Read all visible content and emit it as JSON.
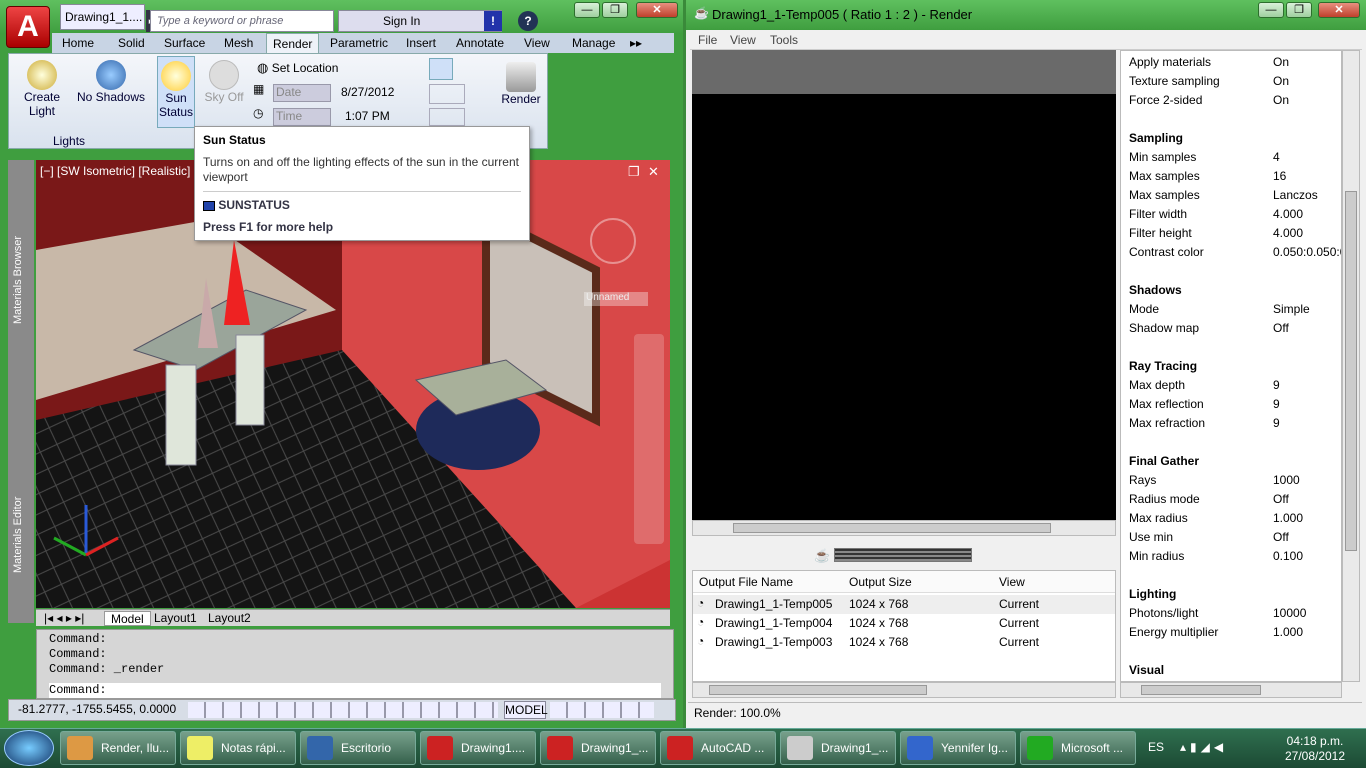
{
  "acad": {
    "title": "Drawing1_1....",
    "search_placeholder": "Type a keyword or phrase",
    "signin": "Sign In",
    "tabs": [
      "Home",
      "Solid",
      "Surface",
      "Mesh",
      "Render",
      "Parametric",
      "Insert",
      "Annotate",
      "View",
      "Manage"
    ],
    "ribbon": {
      "create_light": "Create Light",
      "no_shadows": "No Shadows",
      "sun_status": "Sun Status",
      "sky_off": "Sky Off",
      "set_location": "Set Location",
      "date_label": "Date",
      "date_value": "8/27/2012",
      "time_label": "Time",
      "time_value": "1:07 PM",
      "render": "Render",
      "lights_panel": "Lights"
    },
    "tooltip": {
      "title": "Sun Status",
      "desc": "Turns on and off the lighting effects of the sun in the current viewport",
      "command": "SUNSTATUS",
      "help": "Press F1 for more help"
    },
    "viewport_label": "[−] [SW Isometric] [Realistic]",
    "viewcube_label": "Unnamed",
    "sidebar_top": "Materials Browser",
    "sidebar_bottom": "Materials Editor",
    "layout_tabs": [
      "Model",
      "Layout1",
      "Layout2"
    ],
    "command_lines": [
      "Command:",
      "Command:",
      "Command: _render"
    ],
    "command_prompt": "Command:",
    "coords": "-81.2777, -1755.5455, 0.0000",
    "model_btn": "MODEL"
  },
  "render": {
    "title": "Drawing1_1-Temp005  ( Ratio 1 : 2 ) - Render",
    "menu": [
      "File",
      "View",
      "Tools"
    ],
    "output_headers": [
      "Output File Name",
      "Output Size",
      "View"
    ],
    "outputs": [
      {
        "name": "Drawing1_1-Temp005",
        "size": "1024 x 768",
        "view": "Current"
      },
      {
        "name": "Drawing1_1-Temp004",
        "size": "1024 x 768",
        "view": "Current"
      },
      {
        "name": "Drawing1_1-Temp003",
        "size": "1024 x 768",
        "view": "Current"
      }
    ],
    "status": "Render: 100.0%",
    "props_top": [
      {
        "k": "Apply materials",
        "v": "On"
      },
      {
        "k": "Texture sampling",
        "v": "On"
      },
      {
        "k": "Force 2-sided",
        "v": "On"
      }
    ],
    "sections": [
      {
        "name": "Sampling",
        "rows": [
          {
            "k": "Min samples",
            "v": "4"
          },
          {
            "k": "Max samples",
            "v": "16"
          },
          {
            "k": "Max samples",
            "v": "Lanczos"
          },
          {
            "k": "Filter width",
            "v": "4.000"
          },
          {
            "k": "Filter height",
            "v": "4.000"
          },
          {
            "k": "Contrast color",
            "v": "0.050:0.050:0.0"
          }
        ]
      },
      {
        "name": "Shadows",
        "rows": [
          {
            "k": "Mode",
            "v": "Simple"
          },
          {
            "k": "Shadow map",
            "v": "Off"
          }
        ]
      },
      {
        "name": "Ray Tracing",
        "rows": [
          {
            "k": "Max depth",
            "v": "9"
          },
          {
            "k": "Max reflection",
            "v": "9"
          },
          {
            "k": "Max refraction",
            "v": "9"
          }
        ]
      },
      {
        "name": "Final Gather",
        "rows": [
          {
            "k": "Rays",
            "v": "1000"
          },
          {
            "k": "Radius mode",
            "v": "Off"
          },
          {
            "k": "Max radius",
            "v": "1.000"
          },
          {
            "k": "Use min",
            "v": "Off"
          },
          {
            "k": "Min radius",
            "v": "0.100"
          }
        ]
      },
      {
        "name": "Lighting",
        "rows": [
          {
            "k": "Photons/light",
            "v": "10000"
          },
          {
            "k": "Energy multiplier",
            "v": "1.000"
          }
        ]
      },
      {
        "name": "Visual",
        "rows": []
      }
    ]
  },
  "taskbar": {
    "items": [
      {
        "label": "Render, Ilu...",
        "color": "#d94"
      },
      {
        "label": "Notas rápi...",
        "color": "#ee6"
      },
      {
        "label": "Escritorio",
        "color": "#36a"
      },
      {
        "label": "Drawing1....",
        "color": "#c22"
      },
      {
        "label": "Drawing1_...",
        "color": "#c22"
      },
      {
        "label": "AutoCAD ...",
        "color": "#c22"
      },
      {
        "label": "Drawing1_...",
        "color": "#ccc"
      },
      {
        "label": "Yennifer Ig...",
        "color": "#36c"
      },
      {
        "label": "Microsoft ...",
        "color": "#2a2"
      }
    ],
    "lang": "ES",
    "time": "04:18 p.m.",
    "date": "27/08/2012"
  }
}
